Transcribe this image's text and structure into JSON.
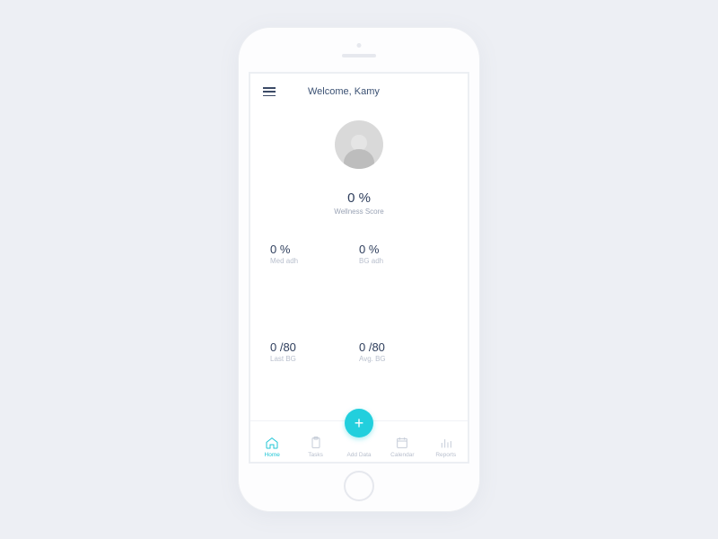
{
  "header": {
    "welcome": "Welcome, Kamy"
  },
  "wellness": {
    "value": "0 %",
    "label": "Wellness Score"
  },
  "stats": {
    "med_adh": {
      "value": "0 %",
      "label": "Med adh"
    },
    "bg_adh": {
      "value": "0 %",
      "label": "BG adh"
    },
    "last_bg": {
      "value": "0  /80",
      "label": "Last BG"
    },
    "avg_bg": {
      "value": "0  /80",
      "label": "Avg. BG"
    }
  },
  "tabs": {
    "home": "Home",
    "tasks": "Tasks",
    "add": "Add Data",
    "calendar": "Calendar",
    "reports": "Reports"
  },
  "colors": {
    "accent": "#22cfdd"
  }
}
